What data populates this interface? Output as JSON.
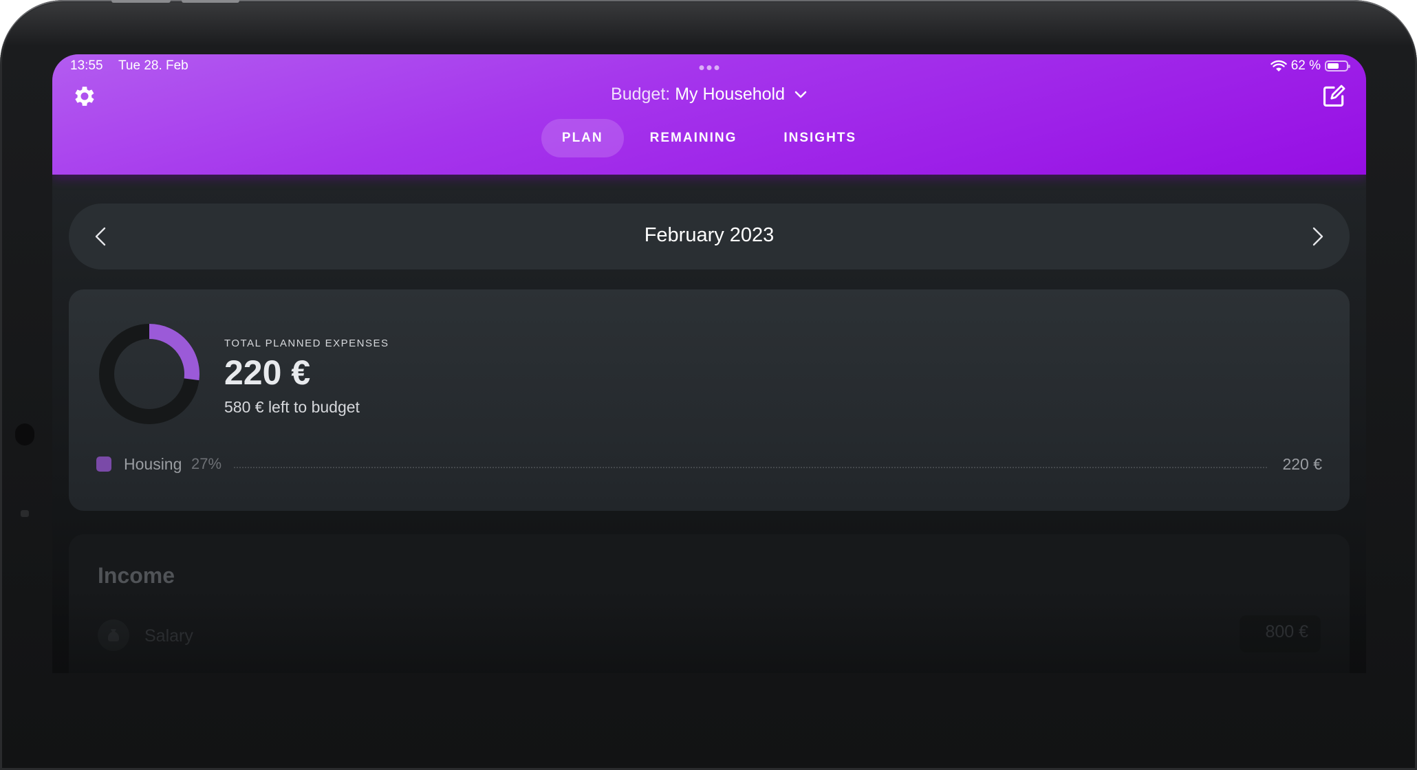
{
  "status_bar": {
    "time": "13:55",
    "date": "Tue 28. Feb",
    "battery": "62 %",
    "battery_level": 0.62
  },
  "header": {
    "budget_label": "Budget:",
    "budget_name": "My Household"
  },
  "tabs": [
    {
      "label": "PLAN",
      "active": true
    },
    {
      "label": "REMAINING",
      "active": false
    },
    {
      "label": "INSIGHTS",
      "active": false
    }
  ],
  "month": {
    "label": "February 2023"
  },
  "summary": {
    "label": "TOTAL PLANNED EXPENSES",
    "total": "220 €",
    "left": "580 € left to budget",
    "planned_fraction": 0.27,
    "categories": [
      {
        "name": "Housing",
        "percent": "27%",
        "amount": "220 €",
        "color": "#7a4aa8"
      }
    ]
  },
  "income": {
    "title": "Income",
    "rows": [
      {
        "name": "Salary",
        "amount": "800 €"
      }
    ]
  },
  "colors": {
    "accent": "#a535ec",
    "donut_fill": "#9b5ad8",
    "donut_track": "#161819"
  }
}
